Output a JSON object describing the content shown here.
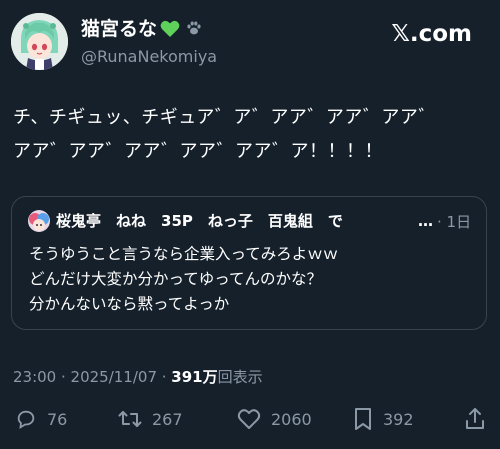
{
  "author": {
    "display_name": "猫宮るな",
    "handle": "@RunaNekomiya"
  },
  "brand": "𝕏.com",
  "tweet": {
    "text": "チ、チギュッ、チギュア゛ア゛アア゛アア゛アア゛\nアア゛アア゛アア゛アア゛アア゛ア！！！！"
  },
  "quote": {
    "name": "桜鬼亭　ねね　35P　ねっ子　百鬼組　で",
    "ellipsis": "…",
    "time": "· 1日",
    "text": "そうゆうこと言うなら企業入ってみろよｗｗ\nどんだけ大変か分かってゆってんのかな？\n分かんないなら黙ってよっか"
  },
  "meta": {
    "time": "23:00 · 2025/11/07 · ",
    "views_count": "391万",
    "views_label": "回表示"
  },
  "actions": {
    "replies": "76",
    "retweets": "267",
    "likes": "2060",
    "bookmarks": "392"
  },
  "colors": {
    "background": "#15202b",
    "text": "#ffffff",
    "secondary": "#8b98a5",
    "border": "#38444d",
    "heart": "#5fd05a"
  }
}
